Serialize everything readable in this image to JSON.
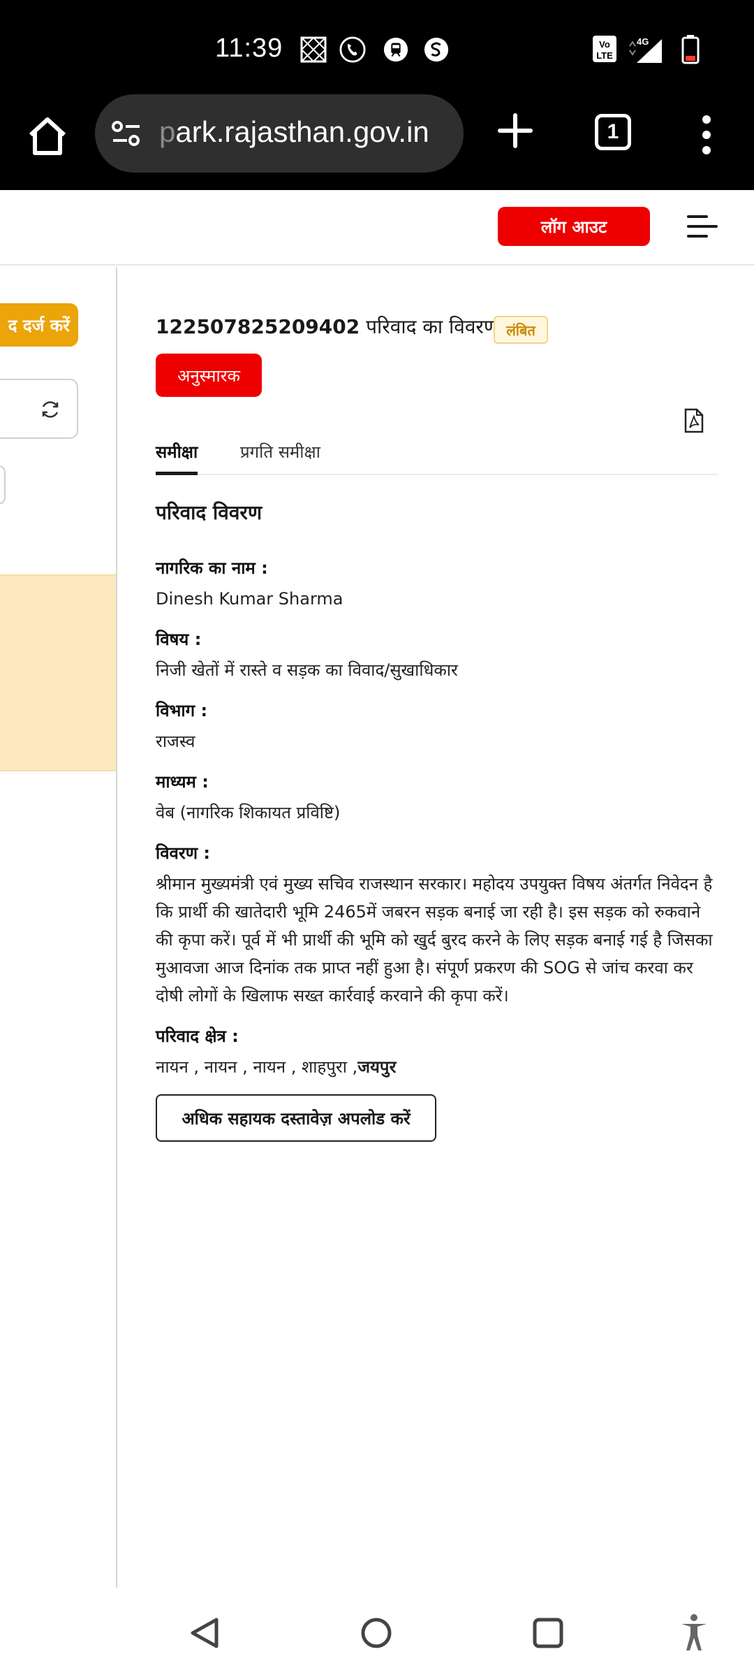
{
  "status_bar": {
    "time": "11:39",
    "icons": [
      "notification-grid-icon",
      "call-icon",
      "train-icon",
      "sync-icon",
      "volte-icon",
      "signal-4g-icon",
      "battery-icon"
    ]
  },
  "browser": {
    "url_faded": "p",
    "url_main": "ark.rajasthan.gov.in",
    "tab_count": "1"
  },
  "header": {
    "logout_label": "लॉग आउट"
  },
  "sidebar": {
    "register_label": "द दर्ज करें"
  },
  "complaint": {
    "number": "122507825209402",
    "title_suffix": " परिवाद का विवरण",
    "status": "लंबित",
    "reminder_label": "अनुस्मारक"
  },
  "tabs": [
    {
      "label": "समीक्षा",
      "active": true
    },
    {
      "label": "प्रगति समीक्षा",
      "active": false
    }
  ],
  "details": {
    "section_title": "परिवाद विवरण",
    "fields": [
      {
        "label": "नागरिक का नाम :",
        "value": "Dinesh Kumar Sharma"
      },
      {
        "label": "विषय :",
        "value": "निजी खेतों में रास्ते व सड़क का विवाद/सुखाधिकार"
      },
      {
        "label": "विभाग :",
        "value": "राजस्व"
      },
      {
        "label": "माध्यम :",
        "value": "वेब (नागरिक शिकायत प्रविष्टि)"
      },
      {
        "label": "विवरण :",
        "value": "श्रीमान मुख्यमंत्री एवं मुख्य सचिव राजस्थान सरकार। महोदय उपयुक्त विषय अंतर्गत निवेदन है कि प्रार्थी की खातेदारी भूमि 2465में जबरन सड़क बनाई जा रही है। इस सड़क को रुकवाने की कृपा करें। पूर्व में भी प्रार्थी की भूमि को खुर्द बुरद करने के लिए सड़क बनाई गई है जिसका मुआवजा आज दिनांक तक प्राप्त नहीं हुआ है। संपूर्ण प्रकरण की SOG से जांच करवा कर दोषी लोगों के खिलाफ सख्त कार्रवाई करवाने की कृपा करें।"
      },
      {
        "label": "परिवाद क्षेत्र :",
        "value_plain": "नायन , नायन , नायन , शाहपुरा ,",
        "value_bold": "जयपुर"
      }
    ],
    "upload_label": "अधिक सहायक दस्तावेज़ अपलोड करें"
  },
  "colors": {
    "primary_red": "#ee0000",
    "accent_orange": "#eba409",
    "status_tag_bg": "#fff7dd",
    "status_tag_text": "#c98a00"
  }
}
